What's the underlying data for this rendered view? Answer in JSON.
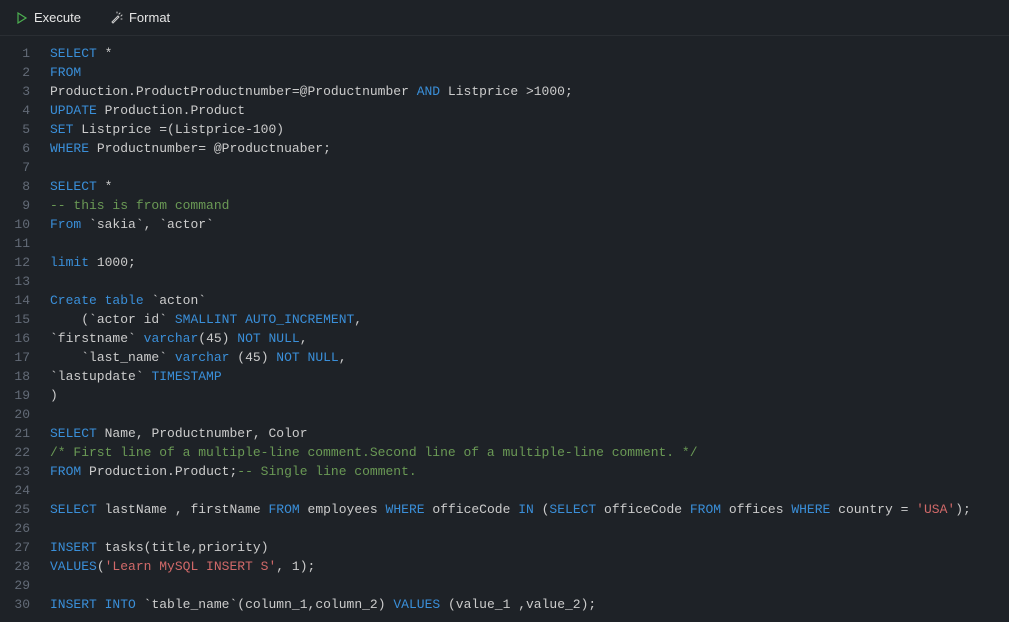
{
  "toolbar": {
    "execute_label": "Execute",
    "format_label": "Format"
  },
  "editor": {
    "lines": [
      "SELECT *",
      "FROM",
      "Production.ProductProductnumber=@Productnumber AND Listprice >1000;",
      "UPDATE Production.Product",
      "SET Listprice =(Listprice-100)",
      "WHERE Productnumber= @Productnuaber;",
      "",
      "SELECT *",
      "-- this is from command",
      "From `sakia`, `actor`",
      "",
      "limit 1000;",
      "",
      "Create table `acton`",
      "    (`actor id` SMALLINT AUTO_INCREMENT,",
      "`firstname` varchar(45) NOT NULL,",
      "    `last_name` varchar (45) NOT NULL,",
      "`lastupdate` TIMESTAMP",
      ")",
      "",
      "SELECT Name, Productnumber, Color",
      "/* First line of a multiple-line comment.Second line of a multiple-line comment. */",
      "FROM Production.Product;-- Single line comment.",
      "",
      "SELECT lastName , firstName FROM employees WHERE officeCode IN (SELECT officeCode FROM offices WHERE country = 'USA');",
      "",
      "INSERT tasks(title,priority)",
      "VALUES('Learn MySQL INSERT S', 1);",
      "",
      "INSERT INTO `table_name`(column_1,column_2) VALUES (value_1 ,value_2);"
    ]
  },
  "colors": {
    "background": "#1e2227",
    "keyword": "#3a8fd9",
    "string": "#d16969",
    "comment": "#6A9955",
    "text": "#cccccc",
    "gutter": "#636b77"
  }
}
